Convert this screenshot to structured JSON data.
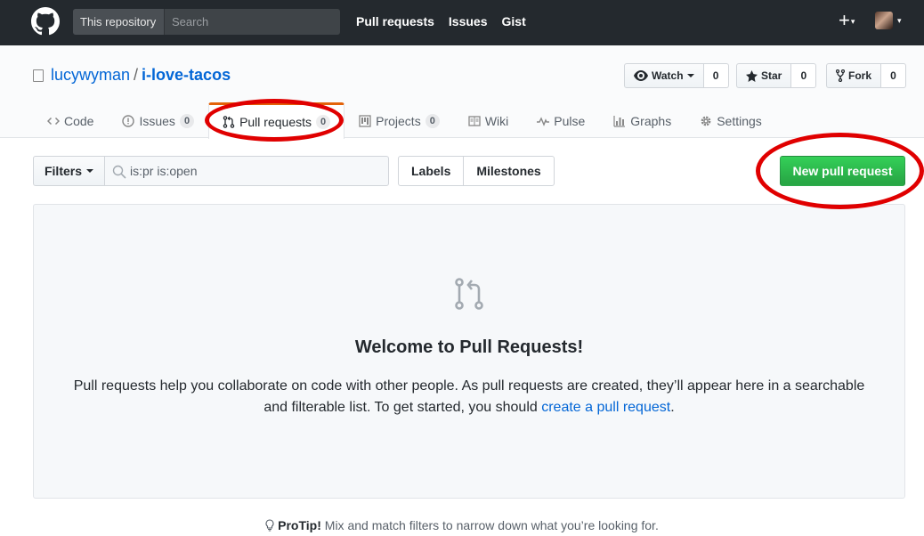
{
  "header": {
    "scope_label": "This repository",
    "search_placeholder": "Search",
    "nav": [
      "Pull requests",
      "Issues",
      "Gist"
    ],
    "plus_symbol": "+"
  },
  "repo": {
    "owner": "lucywyman",
    "separator": "/",
    "name": "i-love-tacos",
    "actions": {
      "watch": {
        "label": "Watch",
        "count": "0"
      },
      "star": {
        "label": "Star",
        "count": "0"
      },
      "fork": {
        "label": "Fork",
        "count": "0"
      }
    },
    "tabs": {
      "code": {
        "label": "Code"
      },
      "issues": {
        "label": "Issues",
        "count": "0"
      },
      "pulls": {
        "label": "Pull requests",
        "count": "0"
      },
      "projects": {
        "label": "Projects",
        "count": "0"
      },
      "wiki": {
        "label": "Wiki"
      },
      "pulse": {
        "label": "Pulse"
      },
      "graphs": {
        "label": "Graphs"
      },
      "settings": {
        "label": "Settings"
      }
    }
  },
  "subnav": {
    "filters_label": "Filters",
    "search_value": "is:pr is:open",
    "labels": "Labels",
    "milestones": "Milestones",
    "new_pr": "New pull request"
  },
  "blankslate": {
    "title": "Welcome to Pull Requests!",
    "text_before": "Pull requests help you collaborate on code with other people. As pull requests are created, they’ll appear here in a searchable and filterable list. To get started, you should ",
    "link": "create a pull request",
    "text_after": "."
  },
  "protip": {
    "label": "ProTip!",
    "text": " Mix and match filters to narrow down what you’re looking for."
  },
  "colors": {
    "header_bg": "#24292e",
    "link": "#0366d6",
    "primary_button": "#28a745",
    "selected_tab_accent": "#e36209",
    "annotation": "#e00000"
  }
}
